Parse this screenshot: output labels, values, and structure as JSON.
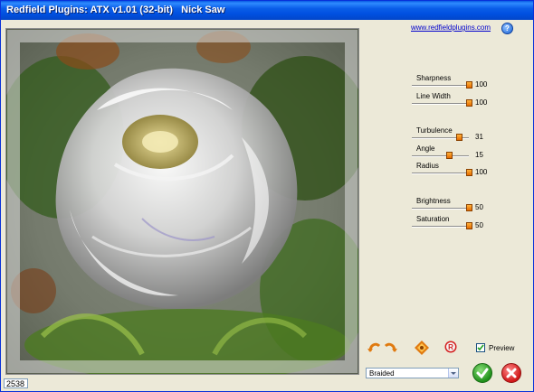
{
  "window": {
    "title": "Redfield Plugins: ATX v1.01 (32-bit)   Nick Saw"
  },
  "header": {
    "link_text": "www.redfieldplugins.com",
    "help_icon": "help-icon"
  },
  "status": {
    "value": "2538"
  },
  "params": [
    {
      "label": "Sharpness",
      "value": "100",
      "fraction": 1.0
    },
    {
      "label": "Line Width",
      "value": "100",
      "fraction": 1.0
    },
    {
      "label": "Turbulence",
      "value": "31",
      "fraction": 0.83
    },
    {
      "label": "Angle",
      "value": "15",
      "fraction": 0.66
    },
    {
      "label": "Radius",
      "value": "100",
      "fraction": 1.0
    },
    {
      "label": "Brightness",
      "value": "50",
      "fraction": 1.0
    },
    {
      "label": "Saturation",
      "value": "50",
      "fraction": 1.0
    }
  ],
  "controls": {
    "preview_label": "Preview",
    "preview_checked": true,
    "style_select": "Braided"
  },
  "colors": {
    "title_bar": "#0A5DE8",
    "slider_thumb": "#F08A10",
    "ok": "#1F8F1A",
    "cancel": "#D11818"
  }
}
